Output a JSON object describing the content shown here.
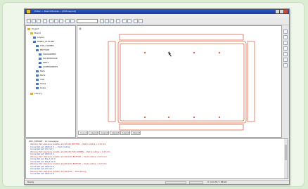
{
  "window": {
    "title": "Editor — Board Module — [PCB Layout]",
    "menu": [
      "File",
      "Edit",
      "View",
      "Place",
      "Route",
      "Tools",
      "Window",
      "Help"
    ]
  },
  "toolbar": {
    "icons": [
      "new-icon",
      "open-icon",
      "save-icon",
      "print-icon",
      "cut-icon",
      "copy-icon",
      "paste-icon",
      "undo-icon",
      "redo-icon",
      "zoom-in-icon",
      "zoom-out-icon",
      "zoom-fit-icon",
      "grid-icon",
      "layer-icon",
      "properties-icon",
      "route-icon",
      "drc-icon"
    ],
    "combo_value": ""
  },
  "tree": {
    "items": [
      {
        "label": "Project",
        "level": 0
      },
      {
        "label": "Board",
        "level": 1
      },
      {
        "label": "Layers",
        "level": 2
      },
      {
        "label": "PANEL_OUTLINE",
        "level": 2
      },
      {
        "label": "TOP_COPPER",
        "level": 3
      },
      {
        "label": "BOTTOM",
        "level": 3
      },
      {
        "label": "SILKSCREEN",
        "level": 4
      },
      {
        "label": "SOLDERMASK",
        "level": 4
      },
      {
        "label": "DRILL",
        "level": 4
      },
      {
        "label": "COMPONENTS",
        "level": 4
      },
      {
        "label": "Nets",
        "level": 3
      },
      {
        "label": "Parts",
        "level": 3
      },
      {
        "label": "Vias",
        "level": 3
      },
      {
        "label": "Holes",
        "level": 3
      },
      {
        "label": "Rules",
        "level": 3
      },
      {
        "label": "Library",
        "level": 1
      }
    ]
  },
  "tabs": [
    "Layout 1",
    "Layout 2",
    "Layout 3",
    "Layout 4",
    "Layout 5",
    "Layout 6"
  ],
  "output": {
    "header": "DRC_REPORT - 12 messages",
    "lines": [
      {
        "text": "Warning: Part clearance violation at (120,45) BOTTOM — Pad to outline < 0.25 mm",
        "color": "red"
      },
      {
        "text": "     Connected net: GND ref. 3 — check routing",
        "color": "blue"
      },
      {
        "text": "     Connected net: VCC ref. 1",
        "color": "blue"
      },
      {
        "text": "Warning: Part clearance violation at (240,45) TOP_COPPER — Pad to outline < 0.25 mm",
        "color": "red"
      },
      {
        "text": "     Connected net: GND ref. 4",
        "color": "blue"
      },
      {
        "text": "Warning: Part clearance violation at (120,165) BOTTOM — Via to outline < 0.25 mm",
        "color": "red"
      },
      {
        "text": "     Connected net: SIG_A ref. 2",
        "color": "blue"
      },
      {
        "text": "     Connected net: SIG_B ref. 5",
        "color": "blue"
      },
      {
        "text": "Warning: Part clearance violation at (240,165) BOTTOM — Via to outline < 0.25 mm",
        "color": "red"
      },
      {
        "text": "     Connected net: GND ref. 6",
        "color": "blue"
      },
      {
        "text": "     Connected net: VCC ref. 7",
        "color": "blue"
      },
      {
        "text": "Warning: Part clearance violation at (180,100) — Pad spacing",
        "color": "red"
      },
      {
        "text": "     Connected net: GND ref. 8",
        "color": "blue"
      }
    ]
  },
  "status": {
    "ready": "Ready",
    "coords": "X: 124.35  Y: 88.20"
  },
  "colors": {
    "accent": "#1a3d9c",
    "outline": "#e0684a",
    "error_text": "#c9291a",
    "info_text": "#274aa5"
  }
}
